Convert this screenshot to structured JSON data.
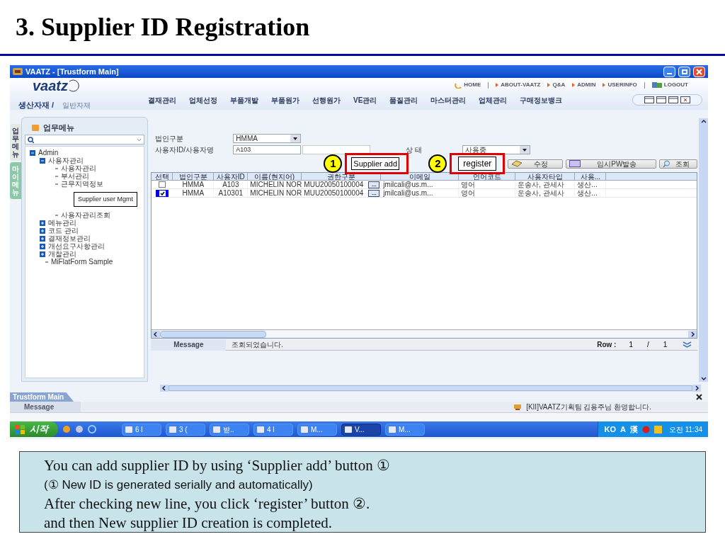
{
  "slide_title": "3. Supplier ID Registration",
  "window": {
    "title": "VAATZ - [Trustform Main]"
  },
  "header": {
    "logo": "vaatz",
    "top_links": [
      {
        "label": "HOME",
        "kind": "home"
      },
      {
        "label": "ABOUT-VAATZ",
        "kind": "bullet"
      },
      {
        "label": "Q&A",
        "kind": "bullet"
      },
      {
        "label": "ADMIN",
        "kind": "bullet"
      },
      {
        "label": "USERINFO",
        "kind": "bullet"
      },
      {
        "label": "LOGOUT",
        "kind": "logout"
      }
    ],
    "divisions": [
      {
        "label": "생산자재 /",
        "selected": true
      },
      {
        "label": "일반자재",
        "selected": false
      }
    ],
    "nav": [
      "결재관리",
      "업체선정",
      "부품개발",
      "부품원가",
      "선행원가",
      "VE관리",
      "품질관리",
      "마스터관리",
      "업체관리",
      "구매정보뱅크"
    ]
  },
  "side_tabs": [
    {
      "label": "업무메뉴",
      "selected": true
    },
    {
      "label": "마이메뉴",
      "selected": false
    }
  ],
  "sidebar": {
    "title": "업무메뉴",
    "tree": [
      {
        "label": "Admin",
        "expanded": true,
        "children": [
          {
            "label": "사용자관리",
            "expanded": true,
            "children": [
              {
                "label": "사용자관리"
              },
              {
                "label": "부서관리"
              },
              {
                "label": "근무지역정보"
              },
              {
                "label": "사용자관리조회"
              }
            ]
          },
          {
            "label": "메뉴관리",
            "expanded": false
          },
          {
            "label": "코드 관리",
            "expanded": false
          },
          {
            "label": "결재정보관리",
            "expanded": false
          },
          {
            "label": "개선요구사항관리",
            "expanded": false
          },
          {
            "label": "개찰관리",
            "expanded": false
          },
          {
            "label": "MiFlatForm Sample"
          }
        ]
      }
    ]
  },
  "form": {
    "corp_label": "법인구분",
    "corp_value": "HMMA",
    "user_label": "사용자ID/사용자명",
    "user_id": "A103",
    "status_label": "상 태",
    "status_value": "사용중"
  },
  "buttons": [
    {
      "label": "수정",
      "kind": "edit"
    },
    {
      "label": "임시PW발송",
      "kind": "pw"
    },
    {
      "label": "조회",
      "kind": "search"
    }
  ],
  "table": {
    "columns": [
      "선택",
      "법인구분",
      "사용자ID",
      "이름(현지어)",
      "권한구분",
      "이메일",
      "언어코드",
      "사용자타입",
      "사용..."
    ],
    "rows": [
      {
        "checked": false,
        "lookup": "...",
        "cells": [
          "",
          "HMMA",
          "A103",
          "MICHELIN NOR",
          "MUU20050100004",
          "jmilcali@us.m...",
          "영어",
          "운송사, 관세사",
          "생산..."
        ]
      },
      {
        "checked": true,
        "lookup": "...",
        "cells": [
          "",
          "HMMA",
          "A10301",
          "MICHELIN NOR",
          "MUU20050100004",
          "jmilcali@us.m...",
          "영어",
          "운송사, 관세사",
          "생산..."
        ]
      }
    ]
  },
  "message_bar": {
    "label": "Message",
    "text": "조회되었습니다.",
    "row_label": "Row :",
    "row_current": "1",
    "separator": "/",
    "row_total": "1"
  },
  "status_panel": {
    "tab": "Trustform Main",
    "label": "Message",
    "text": "[KII]VAATZ기획팀 김용주님 환영합니다."
  },
  "taskbar": {
    "start": "시작",
    "tasks": [
      {
        "label": "6 l",
        "selected": false
      },
      {
        "label": "3 (",
        "selected": false
      },
      {
        "label": "받..",
        "selected": false
      },
      {
        "label": "4 l",
        "selected": false
      },
      {
        "label": "M...",
        "selected": false
      },
      {
        "label": "V...",
        "selected": true
      },
      {
        "label": "M...",
        "selected": false
      }
    ],
    "tray": [
      "KO",
      "A",
      "漢"
    ],
    "clock": "오전 11:34"
  },
  "annotations": [
    {
      "number": "1",
      "label": "Supplier add"
    },
    {
      "number": "2",
      "label": "register"
    }
  ],
  "callout": "Supplier user Mgmt",
  "caption": [
    {
      "kind": "main",
      "text": "You can add supplier ID by using ‘Supplier add’ button ①"
    },
    {
      "kind": "note",
      "text": "(① New ID is generated serially and automatically)"
    },
    {
      "kind": "main",
      "text": "After checking new line, you click ‘register’ button ②."
    },
    {
      "kind": "main",
      "text": "and then New supplier ID creation is completed."
    }
  ]
}
